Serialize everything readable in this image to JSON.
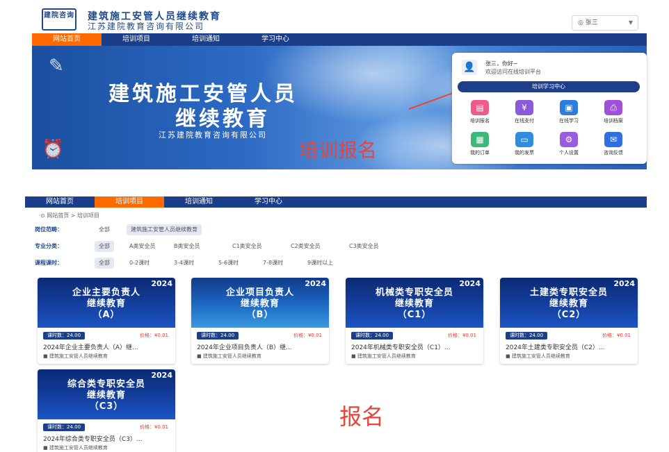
{
  "header": {
    "logo_text": "建院咨询",
    "brand_line1": "建筑施工安管人员继续教育",
    "brand_line2": "江苏建院教育咨询有限公司",
    "user_menu": "张三"
  },
  "nav": [
    "网站首页",
    "培训项目",
    "培训通知",
    "学习中心"
  ],
  "banner": {
    "title_line1": "建筑施工安管人员",
    "title_line2": "继续教育",
    "company": "江苏建院教育咨询有限公司"
  },
  "user_card": {
    "greeting": "张三，你好~",
    "welcome": "欢迎访问在线培训平台",
    "center_button": "培训学习中心",
    "tiles": [
      "培训报名",
      "在线支付",
      "在线学习",
      "培训档案",
      "我的订单",
      "我的发票",
      "个人设置",
      "咨询反馈"
    ]
  },
  "annotations": {
    "signup_hint": "培训报名",
    "signup_hint2": "报名"
  },
  "breadcrumb": "网站首页 > 培训项目",
  "filters": [
    {
      "label": "岗位范畴：",
      "options": [
        "全部",
        "建筑施工安管人员继续教育"
      ],
      "selected": 1
    },
    {
      "label": "专业分类：",
      "options": [
        "全部",
        "A类安全员",
        "B类安全员",
        "C1类安全员",
        "C2类安全员",
        "C3类安全员"
      ],
      "selected": 0
    },
    {
      "label": "课程课时：",
      "options": [
        "全部",
        "0-2课时",
        "3-4课时",
        "5-6课时",
        "7-8课时",
        "9课时以上"
      ],
      "selected": 0
    }
  ],
  "courses": [
    {
      "year": "2024",
      "line1": "企业主要负责人",
      "line2": "继续教育",
      "line3": "（A）",
      "hours": "课时数：24.00",
      "price": "价格：¥0.01",
      "name": "2024年企业主要负责人（A）继...",
      "org": "建筑施工安管人员继续教育"
    },
    {
      "year": "2024",
      "line1": "企业项目负责人",
      "line2": "继续教育",
      "line3": "（B）",
      "hours": "课时数：24.00",
      "price": "价格：¥0.01",
      "name": "2024年企业项目负责人（B）继...",
      "org": "建筑施工安管人员继续教育"
    },
    {
      "year": "2024",
      "line1": "机械类专职安全员",
      "line2": "继续教育",
      "line3": "（C1）",
      "hours": "课时数：24.00",
      "price": "价格：¥0.01",
      "name": "2024年机械类专职安全员（C1）...",
      "org": "建筑施工安管人员继续教育"
    },
    {
      "year": "2024",
      "line1": "土建类专职安全员",
      "line2": "继续教育",
      "line3": "（C2）",
      "hours": "课时数：24.00",
      "price": "价格：¥0.01",
      "name": "2024年土建类专职安全员（C2）...",
      "org": "建筑施工安管人员继续教育"
    },
    {
      "year": "2024",
      "line1": "综合类专职安全员",
      "line2": "继续教育",
      "line3": "（C3）",
      "hours": "课时数：24.00",
      "price": "价格：¥0.01",
      "name": "2024年综合类专职安全员（C3）...",
      "org": "建筑施工安管人员继续教育"
    }
  ],
  "colors": {
    "nav_bg": "#1a3e8a",
    "nav_active": "#ff6a00",
    "annotation": "#e9443a"
  }
}
